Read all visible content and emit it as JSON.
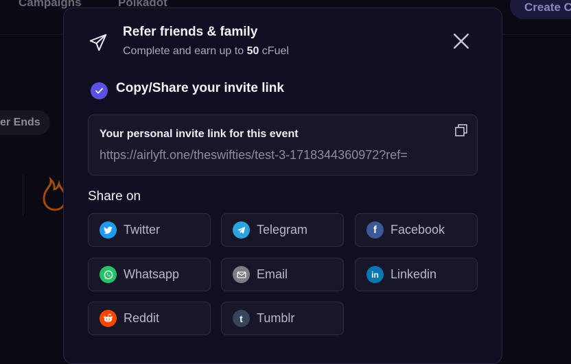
{
  "background": {
    "nav_items": [
      "Campaigns",
      "Polkadot"
    ],
    "create_button": "Create C",
    "pill_label": "er Ends"
  },
  "modal": {
    "title": "Refer friends & family",
    "subtitle_prefix": "Complete and earn up to ",
    "subtitle_amount": "50",
    "subtitle_suffix": " cFuel",
    "step_title": "Copy/Share your invite link",
    "link_label": "Your personal invite link for this event",
    "link_url": "https://airlyft.one/theswifties/test-3-1718344360972?ref=",
    "share_heading": "Share on",
    "share_buttons": [
      {
        "label": "Twitter",
        "icon": "twitter-icon",
        "color": "#1d9bf0"
      },
      {
        "label": "Telegram",
        "icon": "telegram-icon",
        "color": "#2aa3df"
      },
      {
        "label": "Facebook",
        "icon": "facebook-icon",
        "color": "#3b5998"
      },
      {
        "label": "Whatsapp",
        "icon": "whatsapp-icon",
        "color": "#25c26a"
      },
      {
        "label": "Email",
        "icon": "email-icon",
        "color": "#7d7d86"
      },
      {
        "label": "Linkedin",
        "icon": "linkedin-icon",
        "color": "#0a77b5"
      },
      {
        "label": "Reddit",
        "icon": "reddit-icon",
        "color": "#ff4500"
      },
      {
        "label": "Tumblr",
        "icon": "tumblr-icon",
        "color": "#35465c"
      }
    ]
  },
  "colors": {
    "accent": "#5b51e0",
    "modal_bg": "#0f0e22",
    "card_bg": "#181729"
  }
}
